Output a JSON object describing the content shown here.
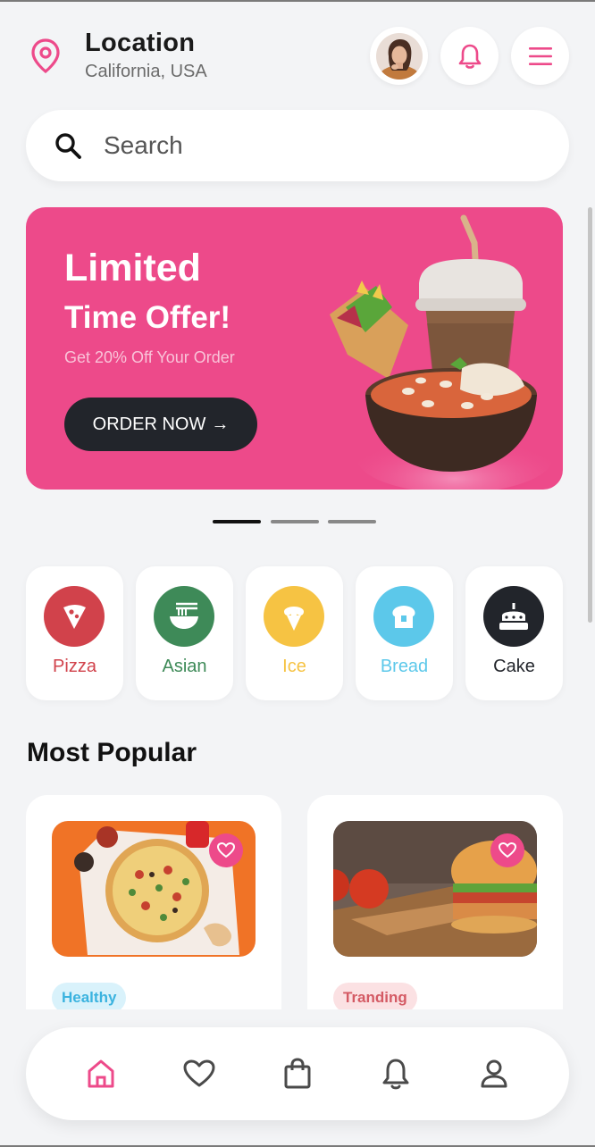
{
  "header": {
    "title": "Location",
    "subtitle": "California, USA",
    "icons": {
      "location": "location-pin-icon",
      "bell": "bell-icon",
      "menu": "hamburger-menu-icon"
    }
  },
  "search": {
    "placeholder": "Search"
  },
  "banner": {
    "title_line1": "Limited",
    "title_line2": "Time Offer!",
    "subtitle": "Get 20% Off Your Order",
    "button": "ORDER NOW",
    "button_icon": "→",
    "carousel": {
      "count": 3,
      "active": 0
    }
  },
  "categories": [
    {
      "label": "Pizza",
      "color": "#d1424b",
      "icon": "pizza-icon"
    },
    {
      "label": "Asian",
      "color": "#3e8a58",
      "icon": "noodles-icon"
    },
    {
      "label": "Ice",
      "color": "#f6c343",
      "icon": "ice-cream-icon"
    },
    {
      "label": "Bread",
      "color": "#5cc8ea",
      "icon": "bread-icon"
    },
    {
      "label": "Cake",
      "color": "#22252b",
      "icon": "cake-icon"
    }
  ],
  "popular": {
    "title": "Most Popular",
    "items": [
      {
        "tag": "Healthy",
        "tag_style": "healthy"
      },
      {
        "tag": "Tranding",
        "tag_style": "trend"
      }
    ]
  },
  "nav": [
    {
      "name": "home",
      "icon": "home-icon",
      "active": true
    },
    {
      "name": "favorites",
      "icon": "heart-icon",
      "active": false
    },
    {
      "name": "cart",
      "icon": "shopping-bag-icon",
      "active": false
    },
    {
      "name": "notifications",
      "icon": "bell-icon",
      "active": false
    },
    {
      "name": "profile",
      "icon": "user-icon",
      "active": false
    }
  ],
  "colors": {
    "accent": "#ed4a8a",
    "dark": "#22252b",
    "background": "#f3f4f6"
  }
}
